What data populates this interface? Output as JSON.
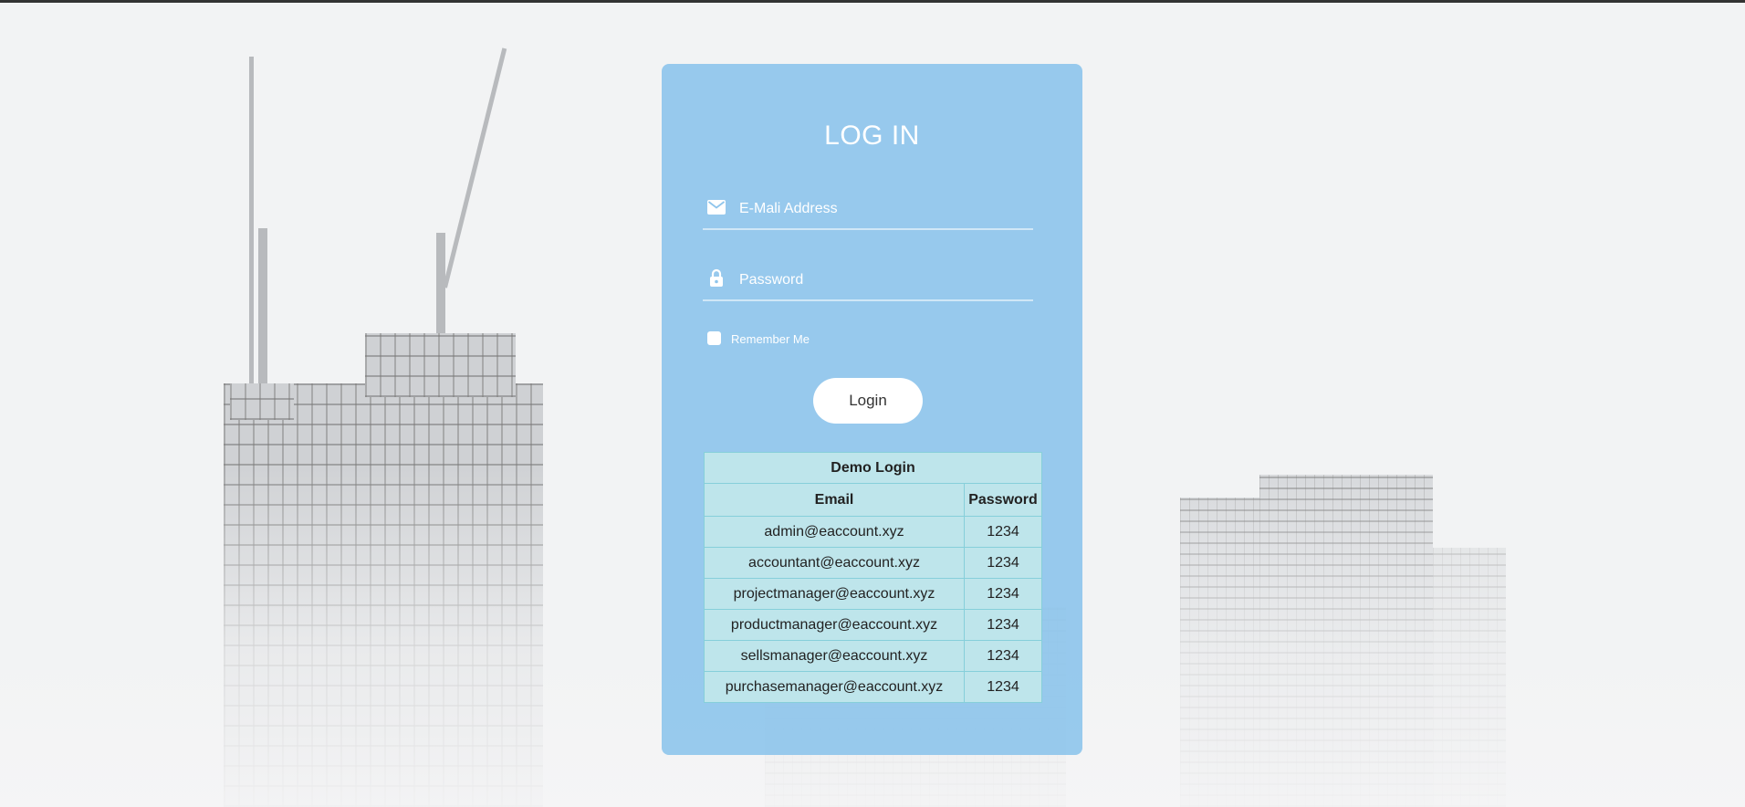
{
  "login": {
    "title": "LOG IN",
    "email_placeholder": "E-Mali Address",
    "password_placeholder": "Password",
    "remember_label": "Remember Me",
    "button_label": "Login"
  },
  "demo": {
    "caption": "Demo Login",
    "headers": {
      "email": "Email",
      "password": "Password"
    },
    "rows": [
      {
        "email": "admin@eaccount.xyz",
        "password": "1234"
      },
      {
        "email": "accountant@eaccount.xyz",
        "password": "1234"
      },
      {
        "email": "projectmanager@eaccount.xyz",
        "password": "1234"
      },
      {
        "email": "productmanager@eaccount.xyz",
        "password": "1234"
      },
      {
        "email": "sellsmanager@eaccount.xyz",
        "password": "1234"
      },
      {
        "email": "purchasemanager@eaccount.xyz",
        "password": "1234"
      }
    ]
  },
  "icons": {
    "email": "envelope-icon",
    "password": "lock-icon"
  },
  "colors": {
    "card": "#8fc5ec",
    "table": "#bee5eb",
    "button": "#ffffff"
  }
}
